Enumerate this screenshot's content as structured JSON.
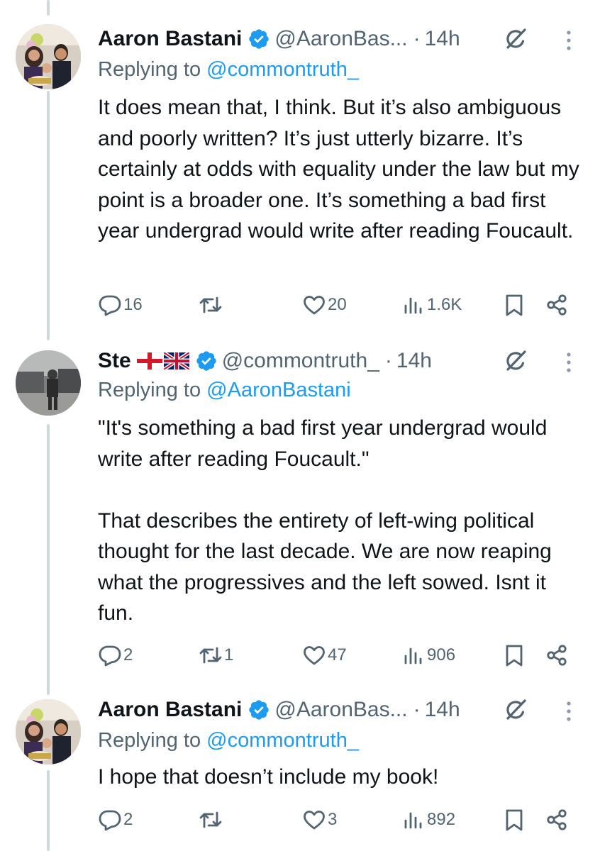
{
  "tweets": [
    {
      "author_name": "Aaron Bastani",
      "handle": "@AaronBas...",
      "dot": "·",
      "time": "14h",
      "replying_label": "Replying to",
      "replying_to": "@commontruth_",
      "verified": true,
      "text": "It does mean that, I think. But it’s also ambiguous and poorly written? It’s just utterly bizarre. It’s certainly at odds with equality under the law but my point is a broader one. It’s something a bad first year undergrad would write after reading Foucault.",
      "replies": "16",
      "retweets": "",
      "likes": "20",
      "views": "1.6K"
    },
    {
      "author_name": "Ste",
      "flags": [
        "flag-england",
        "flag-united-kingdom"
      ],
      "handle": "@commontruth_",
      "dot": "·",
      "time": "14h",
      "replying_label": "Replying to",
      "replying_to": "@AaronBastani",
      "verified": true,
      "text": "\"It's something a bad first year undergrad would write after reading Foucault.\"\n\nThat describes the entirety of left-wing political thought for the last decade. We are now reaping what the progressives and the left sowed. Isnt it fun.",
      "replies": "2",
      "retweets": "1",
      "likes": "47",
      "views": "906"
    },
    {
      "author_name": "Aaron Bastani",
      "handle": "@AaronBas...",
      "dot": "·",
      "time": "14h",
      "replying_label": "Replying to",
      "replying_to": "@commontruth_",
      "verified": true,
      "text": "I hope that doesn’t include my book!",
      "replies": "2",
      "retweets": "",
      "likes": "3",
      "views": "892"
    }
  ],
  "icons": {
    "verified": "verified-badge-icon",
    "grok": "grok-icon",
    "more": "more-options-icon",
    "reply": "reply-icon",
    "retweet": "retweet-icon",
    "like": "like-icon",
    "views": "views-icon",
    "bookmark": "bookmark-icon",
    "share": "share-icon"
  },
  "colors": {
    "text": "#0f1419",
    "muted": "#536471",
    "link": "#1d9bf0",
    "thread_line": "#cfd9de"
  }
}
